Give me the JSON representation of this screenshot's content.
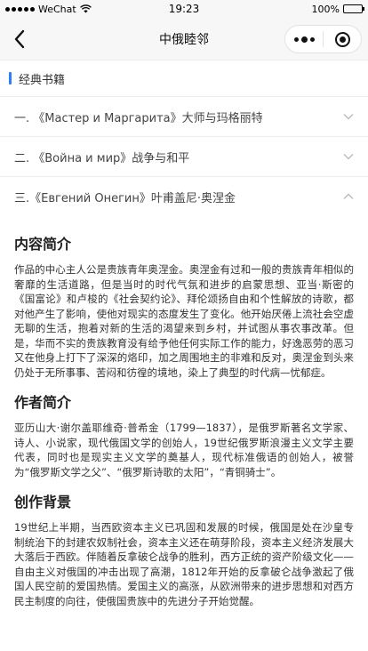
{
  "status_bar": {
    "carrier": "WeChat",
    "time": "19:23",
    "battery": "100%",
    "battery_level": 1.0
  },
  "nav": {
    "title": "中俄睦邻"
  },
  "section": {
    "title": "经典书籍"
  },
  "books": [
    {
      "title": "一. 《Мастер и Маргарита》大师与玛格丽特",
      "expanded": false
    },
    {
      "title": "二. 《Война и мир》战争与和平",
      "expanded": false
    },
    {
      "title": "三.《Евгений Онегин》叶甫盖尼·奥涅金",
      "expanded": true
    }
  ],
  "detail": {
    "intro_heading": "内容简介",
    "intro_text": "作品的中心主人公是贵族青年奥涅金。奥涅金有过和一般的贵族青年相似的奢靡的生活道路，但是当时的时代气氛和进步的启蒙思想、亚当·斯密的《国富论》和卢梭的《社会契约论》、拜伦颂扬自由和个性解放的诗歌，都对他产生了影响，使他对现实的态度发生了变化。他开始厌倦上流社会空虚无聊的生活，抱着对新的生活的渴望来到乡村，并试图从事农事改革。但是，华而不实的贵族教育没有给予他任何实际工作的能力，好逸恶劳的恶习又在他身上打下了深深的烙印，加之周围地主的非难和反对，奥涅金到头来仍处于无所事事、苦闷和彷徨的境地，染上了典型的时代病—忧郁症。",
    "author_heading": "作者简介",
    "author_text": "亚历山大·谢尔盖耶维奇·普希金（1799—1837），是俄罗斯著名文学家、诗人、小说家，现代俄国文学的创始人，19世纪俄罗斯浪漫主义文学主要代表，同时也是现实主义文学的奠基人，现代标准俄语的创始人，被誉为“俄罗斯文学之父”、“俄罗斯诗歌的太阳”，“青铜骑士”。",
    "background_heading": "创作背景",
    "background_text": "19世纪上半期，当西欧资本主义已巩固和发展的时候，俄国是处在沙皇专制统治下的封建农奴制社会，资本主义还在萌芽阶段，资本主义经济发展大大落后于西欧。伴随着反拿破仑战争的胜利，西方正统的资产阶级文化——自由主义对俄国的冲击出现了高潮，1812年开始的反拿破仑战争激起了俄国人民空前的爱国热情。爱国主义的高涨，从欧洲带来的进步思想和对西方民主制度的向往，使俄国贵族中的先进分子开始觉醒。"
  },
  "icons": {
    "back": "chevron-left-icon",
    "more": "more-dots-icon",
    "close": "target-close-icon",
    "collapsed": "chevron-down-icon",
    "expanded": "chevron-up-icon"
  },
  "colors": {
    "accent": "#2d7ff9",
    "nav_bg": "#f7f7f7"
  }
}
